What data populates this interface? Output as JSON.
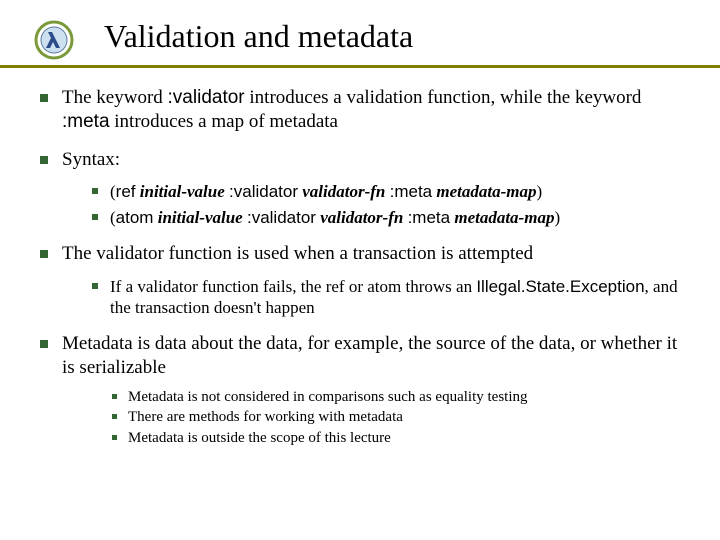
{
  "title": "Validation and metadata",
  "bullets": [
    {
      "html": "The keyword <span class='code'>:validator</span> introduces a validation function, while the keyword <span class='code'>:meta</span> introduces a map of metadata"
    },
    {
      "html": "Syntax:",
      "children": [
        {
          "html": "(<span class='code'>ref</span> <span class='bi'>initial-value</span> <span class='code'>:validator</span> <span class='bi'>validator-fn</span> <span class='code'>:meta</span> <span class='bi'>metadata-map</span>)"
        },
        {
          "html": "(<span class='code'>atom</span> <span class='bi'>initial-value</span> <span class='code'>:validator</span> <span class='bi'>validator-fn</span> <span class='code'>:meta</span> <span class='bi'>metadata-map</span>)"
        }
      ]
    },
    {
      "html": "The validator function is used when a transaction is attempted",
      "children": [
        {
          "html": "If a validator function fails, the ref or atom throws an <span class='code'>Illegal.State.Exception</span>, and the transaction doesn't happen"
        }
      ]
    },
    {
      "html": "Metadata is data about the data, for example, the source of the data, or whether it is serializable",
      "children3": [
        {
          "html": "Metadata is not considered in comparisons such as equality testing"
        },
        {
          "html": "There are methods for working with metadata"
        },
        {
          "html": "Metadata is outside the scope of this lecture"
        }
      ]
    }
  ]
}
